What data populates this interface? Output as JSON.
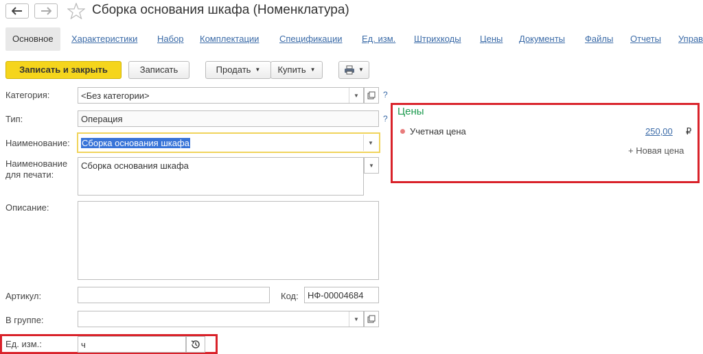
{
  "window": {
    "title": "Сборка основания шкафа (Номенклатура)"
  },
  "nav": {
    "back_icon": "arrow-left-icon",
    "forward_icon": "arrow-right-icon",
    "favorite_icon": "star-icon"
  },
  "tabs": [
    {
      "label": "Основное",
      "active": true
    },
    {
      "label": "Характеристики"
    },
    {
      "label": "Набор"
    },
    {
      "label": "Комплектации"
    },
    {
      "label": "Спецификации"
    },
    {
      "label": "Ед. изм."
    },
    {
      "label": "Штрихкоды"
    },
    {
      "label": "Цены"
    },
    {
      "label": "Документы"
    },
    {
      "label": "Файлы"
    },
    {
      "label": "Отчеты"
    },
    {
      "label": "Управ"
    }
  ],
  "toolbar": {
    "save_close_label": "Записать и закрыть",
    "save_label": "Записать",
    "sell_label": "Продать",
    "buy_label": "Купить",
    "print_icon": "printer-icon"
  },
  "form": {
    "category_label": "Категория:",
    "category_value": "<Без категории>",
    "type_label": "Тип:",
    "type_value": "Операция",
    "name_label": "Наименование:",
    "name_value": "Сборка основания шкафа",
    "print_name_label_1": "Наименование",
    "print_name_label_2": "для печати:",
    "print_name_value": "Сборка основания шкафа",
    "description_label": "Описание:",
    "description_value": "",
    "article_label": "Артикул:",
    "article_value": "",
    "code_label": "Код:",
    "code_value": "НФ-00004684",
    "group_label": "В группе:",
    "group_value": "",
    "unit_label": "Ед. изм.:",
    "unit_value": "ч",
    "help_mark": "?"
  },
  "prices": {
    "title": "Цены",
    "item_label": "Учетная цена",
    "item_value": "250,00",
    "currency": "₽",
    "new_price_label": "+ Новая цена",
    "title_color": "#1c9a4e",
    "dot_color": "#e87c7c"
  },
  "highlight_color": "#d9222a"
}
